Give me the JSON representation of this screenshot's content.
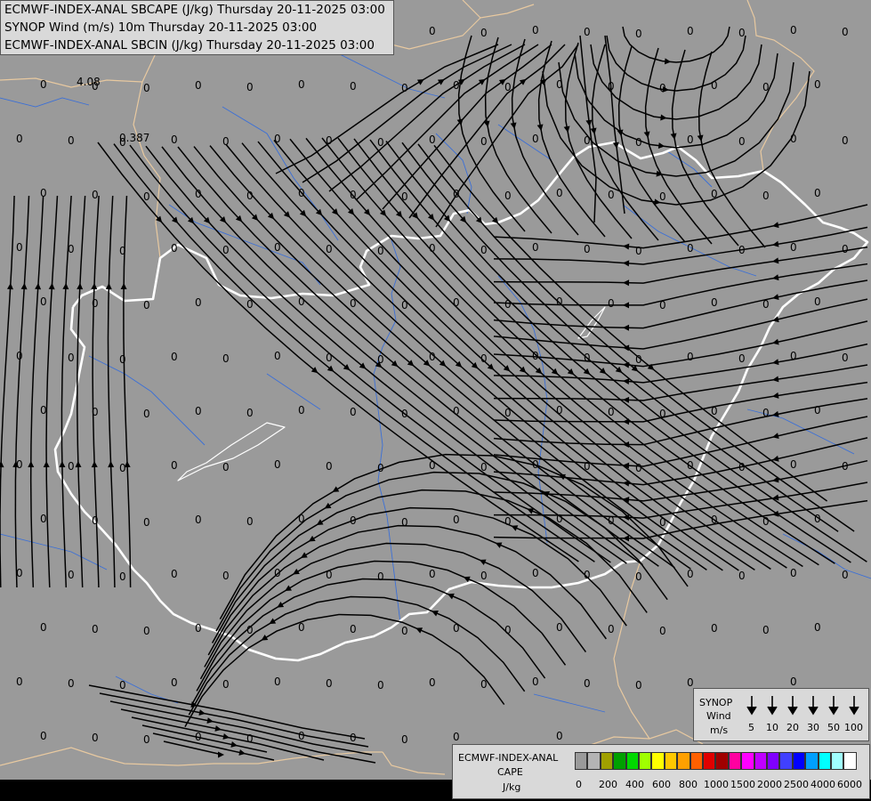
{
  "titles": [
    "ECMWF-INDEX-ANAL SBCAPE (J/kg) Thursday 20-11-2025 03:00",
    "SYNOP Wind (m/s) 10m Thursday 20-11-2025 03:00",
    "ECMWF-INDEX-ANAL SBCIN (J/kg) Thursday 20-11-2025 03:00"
  ],
  "map_values": {
    "common": "0",
    "special": [
      "4.08",
      "0.387"
    ]
  },
  "wind_legend": {
    "label_lines": [
      "SYNOP",
      "Wind",
      "m/s"
    ],
    "speeds": [
      "5",
      "10",
      "20",
      "30",
      "50",
      "100"
    ]
  },
  "cape_legend": {
    "label_lines": [
      "ECMWF-INDEX-ANAL",
      "CAPE",
      "J/kg"
    ],
    "ticks": [
      "0",
      "200",
      "400",
      "600",
      "800",
      "1000",
      "1500",
      "2000",
      "2500",
      "4000",
      "6000"
    ],
    "colors": [
      "#9a9a9a",
      "#b4b4b4",
      "#a0a000",
      "#00a000",
      "#00d800",
      "#a0ff00",
      "#ffff00",
      "#ffc800",
      "#ffa000",
      "#ff6000",
      "#e00000",
      "#a00000",
      "#ff00a0",
      "#ff00ff",
      "#c000ff",
      "#8000ff",
      "#4040ff",
      "#0000ff",
      "#00a0ff",
      "#00ffff",
      "#a0ffff",
      "#ffffff"
    ]
  },
  "colors": {
    "background": "#9a9a9a",
    "streamlines": "#000000",
    "border": "#ffffff",
    "neighbour_border": "#e8c9a0",
    "rivers": "#3a6fd8"
  }
}
